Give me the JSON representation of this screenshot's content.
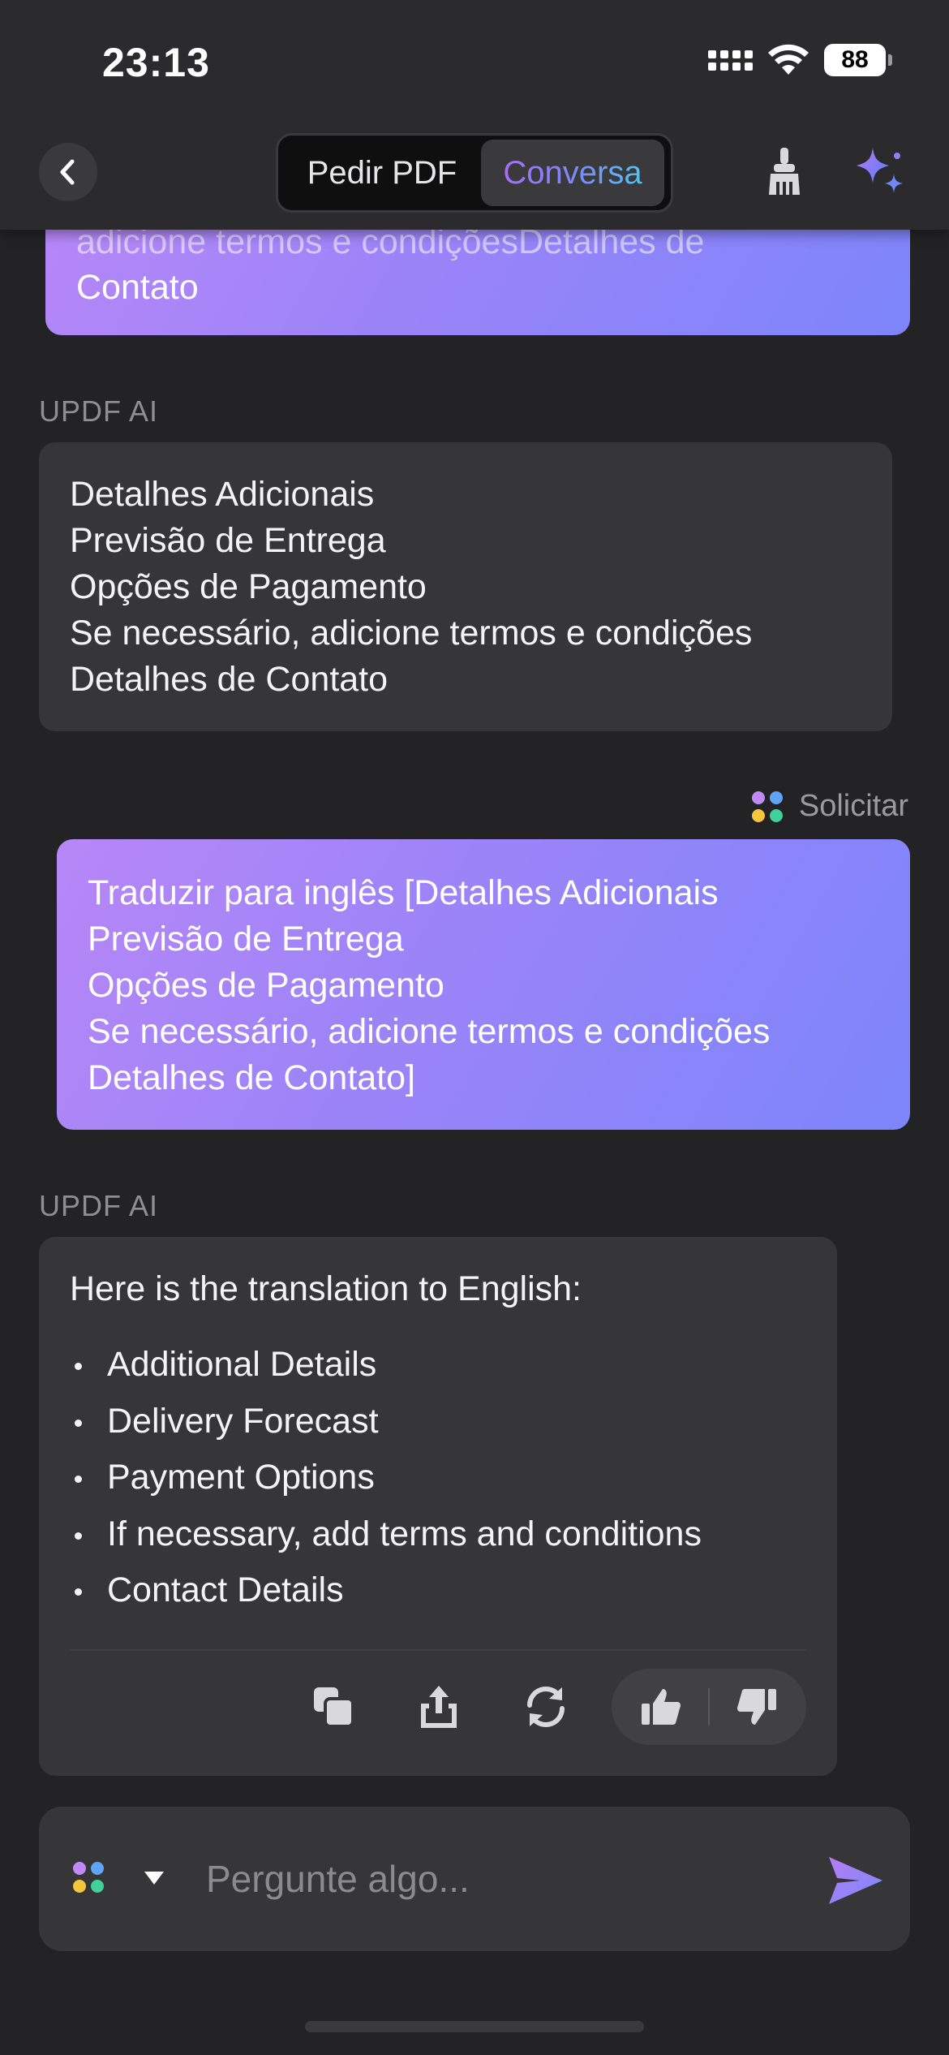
{
  "status_bar": {
    "time": "23:13",
    "battery": "88"
  },
  "nav": {
    "tab_pdf": "Pedir PDF",
    "tab_chat": "Conversa",
    "active_tab": "Conversa"
  },
  "messages": [
    {
      "role": "user",
      "partial_hidden_line": "adicione termos e condiçõesDetalhes de",
      "lines": [
        "Contato"
      ]
    },
    {
      "role": "ai",
      "label": "UPDF AI",
      "lines": [
        "Detalhes Adicionais",
        "Previsão de Entrega",
        "Opções de Pagamento",
        "Se necessário, adicione termos e condições",
        "Detalhes de Contato"
      ]
    },
    {
      "role": "user",
      "tag": "Solicitar",
      "lines": [
        "Traduzir para inglês [Detalhes Adicionais",
        "Previsão de Entrega",
        "Opções de Pagamento",
        "Se necessário, adicione termos e condições",
        "Detalhes de Contato]"
      ]
    },
    {
      "role": "ai",
      "label": "UPDF AI",
      "intro": "Here is the translation to English:",
      "bullets": [
        "Additional Details",
        "Delivery Forecast",
        "Payment Options",
        "If necessary, add terms and conditions",
        "Contact Details"
      ]
    }
  ],
  "input": {
    "placeholder": "Pergunte algo..."
  },
  "colors": {
    "accent_purple": "#a66ef5",
    "accent_blue": "#4fc3f7",
    "user_bubble_start": "#b787f7",
    "user_bubble_end": "#7d85fb",
    "dot_purple": "#c08af5",
    "dot_blue": "#5fa4f6",
    "dot_yellow": "#f6c53e",
    "dot_green": "#41cf9a"
  },
  "icons": {
    "back": "chevron-left-icon",
    "clean": "broom-icon",
    "assistant": "sparkles-icon",
    "copy": "copy-icon",
    "share": "share-icon",
    "regenerate": "refresh-icon",
    "like": "thumbs-up-icon",
    "dislike": "thumbs-down-icon",
    "send": "send-icon"
  }
}
